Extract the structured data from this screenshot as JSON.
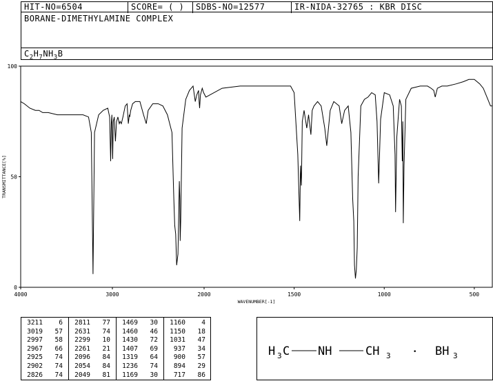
{
  "header": {
    "hit_no": "HIT-NO=6504",
    "score": "SCORE=  (   )",
    "sdbs_no": "SDBS-NO=12577",
    "ir_nida": "IR-NIDA-32765 : KBR DISC"
  },
  "compound_name": "BORANE-DIMETHYLAMINE COMPLEX",
  "formula": {
    "parts": [
      {
        "t": "C",
        "sub": false
      },
      {
        "t": "2",
        "sub": true
      },
      {
        "t": "H",
        "sub": false
      },
      {
        "t": "7",
        "sub": true
      },
      {
        "t": "NH",
        "sub": false
      },
      {
        "t": "3",
        "sub": true
      },
      {
        "t": "B",
        "sub": false
      }
    ]
  },
  "structure": {
    "ch3_left": "H",
    "ch3_left_sub": "3",
    "ch3_left_c": "C",
    "nh": "NH",
    "ch3_right": "CH",
    "ch3_right_sub": "3",
    "dot": "•",
    "bh3": "BH",
    "bh3_sub": "3"
  },
  "peak_table": [
    [
      [
        "3211",
        "6"
      ],
      [
        "2811",
        "77"
      ],
      [
        "1469",
        "30"
      ],
      [
        "1160",
        "4"
      ]
    ],
    [
      [
        "3019",
        "57"
      ],
      [
        "2631",
        "74"
      ],
      [
        "1460",
        "46"
      ],
      [
        "1150",
        "18"
      ]
    ],
    [
      [
        "2997",
        "58"
      ],
      [
        "2299",
        "10"
      ],
      [
        "1430",
        "72"
      ],
      [
        "1031",
        "47"
      ]
    ],
    [
      [
        "2967",
        "66"
      ],
      [
        "2261",
        "21"
      ],
      [
        "1407",
        "69"
      ],
      [
        "937",
        "34"
      ]
    ],
    [
      [
        "2925",
        "74"
      ],
      [
        "2096",
        "84"
      ],
      [
        "1319",
        "64"
      ],
      [
        "900",
        "57"
      ]
    ],
    [
      [
        "2902",
        "74"
      ],
      [
        "2054",
        "84"
      ],
      [
        "1236",
        "74"
      ],
      [
        "894",
        "29"
      ]
    ],
    [
      [
        "2826",
        "74"
      ],
      [
        "2049",
        "81"
      ],
      [
        "1169",
        "30"
      ],
      [
        "717",
        "86"
      ]
    ]
  ],
  "chart_data": {
    "type": "line",
    "title": "",
    "xlabel": "WAVENUMBER[-1]",
    "ylabel": "TRANSMITTANCE[%]",
    "xlim": [
      4000,
      400
    ],
    "ylim": [
      0,
      100
    ],
    "x_ticks": [
      4000,
      3000,
      2000,
      1500,
      1000,
      500
    ],
    "y_ticks": [
      0,
      50,
      100
    ],
    "grid": false,
    "series": [
      {
        "x": [
          4000,
          3960,
          3900,
          3840,
          3800,
          3760,
          3700,
          3600,
          3500,
          3400,
          3320,
          3260,
          3230,
          3211,
          3195,
          3150,
          3100,
          3050,
          3030,
          3019,
          3012,
          3005,
          2997,
          2990,
          2980,
          2967,
          2955,
          2940,
          2925,
          2915,
          2902,
          2885,
          2860,
          2840,
          2826,
          2815,
          2811,
          2800,
          2780,
          2750,
          2700,
          2660,
          2631,
          2610,
          2560,
          2500,
          2450,
          2400,
          2350,
          2330,
          2320,
          2310,
          2299,
          2285,
          2270,
          2265,
          2261,
          2255,
          2240,
          2200,
          2160,
          2120,
          2096,
          2080,
          2060,
          2054,
          2049,
          2040,
          2020,
          2005,
          1990,
          1900,
          1800,
          1700,
          1600,
          1520,
          1500,
          1480,
          1469,
          1465,
          1460,
          1455,
          1445,
          1430,
          1420,
          1407,
          1400,
          1390,
          1370,
          1350,
          1330,
          1319,
          1300,
          1280,
          1250,
          1236,
          1220,
          1200,
          1185,
          1175,
          1169,
          1165,
          1160,
          1155,
          1150,
          1145,
          1130,
          1110,
          1090,
          1070,
          1050,
          1040,
          1031,
          1020,
          1000,
          970,
          950,
          940,
          937,
          930,
          915,
          905,
          900,
          897,
          894,
          890,
          880,
          850,
          800,
          760,
          740,
          725,
          717,
          705,
          680,
          650,
          600,
          560,
          530,
          500,
          470,
          450,
          430,
          410,
          400
        ],
        "y": [
          84,
          83,
          81,
          80,
          80,
          79,
          79,
          78,
          78,
          78,
          78,
          77,
          70,
          6,
          70,
          78,
          80,
          81,
          77,
          57,
          74,
          78,
          58,
          75,
          77,
          66,
          75,
          77,
          74,
          75,
          74,
          77,
          82,
          83,
          74,
          78,
          77,
          80,
          83,
          84,
          84,
          78,
          74,
          80,
          83,
          83,
          82,
          78,
          70,
          40,
          28,
          24,
          10,
          15,
          48,
          40,
          21,
          30,
          72,
          85,
          89,
          91,
          84,
          87,
          89,
          84,
          81,
          87,
          90,
          88,
          86,
          90,
          91,
          91,
          91,
          91,
          88,
          60,
          30,
          55,
          46,
          75,
          80,
          72,
          78,
          69,
          80,
          82,
          84,
          82,
          72,
          64,
          80,
          84,
          82,
          74,
          80,
          82,
          70,
          40,
          30,
          10,
          4,
          8,
          18,
          50,
          82,
          85,
          86,
          88,
          87,
          75,
          47,
          76,
          88,
          87,
          82,
          60,
          34,
          68,
          85,
          82,
          57,
          75,
          29,
          55,
          85,
          90,
          91,
          91,
          90,
          89,
          86,
          90,
          91,
          91,
          92,
          93,
          94,
          94,
          92,
          90,
          86,
          82,
          82
        ]
      }
    ]
  }
}
